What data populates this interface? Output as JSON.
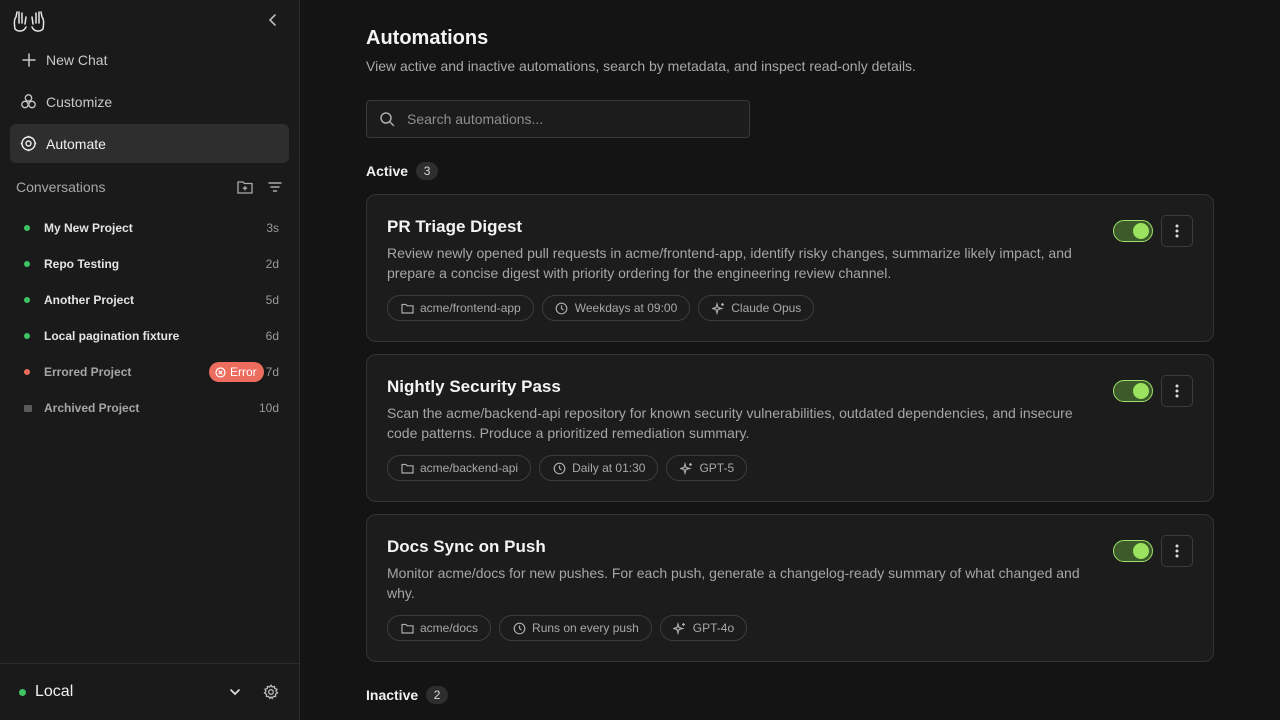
{
  "sidebar": {
    "nav": [
      {
        "label": "New Chat",
        "icon": "plus-icon"
      },
      {
        "label": "Customize",
        "icon": "customize-icon"
      },
      {
        "label": "Automate",
        "icon": "automate-icon",
        "active": true
      }
    ],
    "conversations_label": "Conversations",
    "conversations": [
      {
        "title": "My New Project",
        "time": "3s",
        "status": "green"
      },
      {
        "title": "Repo Testing",
        "time": "2d",
        "status": "green"
      },
      {
        "title": "Another Project",
        "time": "5d",
        "status": "green"
      },
      {
        "title": "Local pagination fixture",
        "time": "6d",
        "status": "green"
      },
      {
        "title": "Errored Project",
        "time": "7d",
        "status": "red",
        "badge": "Error"
      },
      {
        "title": "Archived Project",
        "time": "10d",
        "status": "archived"
      }
    ],
    "footer": {
      "environment": "Local"
    }
  },
  "main": {
    "title": "Automations",
    "subtitle": "View active and inactive automations, search by metadata, and inspect read-only details.",
    "search_placeholder": "Search automations...",
    "active_label": "Active",
    "active_count": "3",
    "inactive_label": "Inactive",
    "inactive_count": "2",
    "automations": [
      {
        "title": "PR Triage Digest",
        "description": "Review newly opened pull requests in acme/frontend-app, identify risky changes, summarize likely impact, and prepare a concise digest with priority ordering for the engineering review channel.",
        "repo": "acme/frontend-app",
        "schedule": "Weekdays at 09:00",
        "model": "Claude Opus",
        "enabled": true
      },
      {
        "title": "Nightly Security Pass",
        "description": "Scan the acme/backend-api repository for known security vulnerabilities, outdated dependencies, and insecure code patterns. Produce a prioritized remediation summary.",
        "repo": "acme/backend-api",
        "schedule": "Daily at 01:30",
        "model": "GPT-5",
        "enabled": true
      },
      {
        "title": "Docs Sync on Push",
        "description": "Monitor acme/docs for new pushes. For each push, generate a changelog-ready summary of what changed and why.",
        "repo": "acme/docs",
        "schedule": "Runs on every push",
        "model": "GPT-4o",
        "enabled": true
      }
    ]
  },
  "colors": {
    "accent_green": "#9be35e",
    "status_green": "#3ec463",
    "error_red": "#ec6c5e"
  }
}
